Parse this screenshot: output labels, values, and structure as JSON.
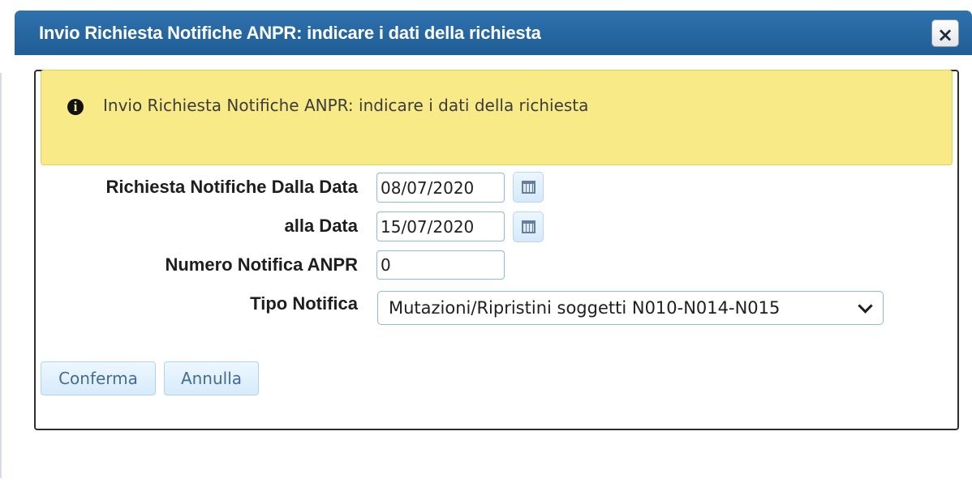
{
  "window": {
    "title": "Invio Richiesta Notifiche ANPR: indicare i dati della richiesta",
    "close_symbol": "×",
    "close_icon": "close-icon",
    "header_color": "#1f5d95"
  },
  "notice": {
    "icon": "info-icon",
    "icon_text": "i",
    "message": "Invio Richiesta Notifiche ANPR:  indicare i dati della richiesta",
    "background": "#f9ea88"
  },
  "form": {
    "from_date": {
      "label": "Richiesta Notifiche Dalla Data",
      "value": "08/07/2020",
      "icon": "calendar-icon"
    },
    "to_date": {
      "label": "alla Data",
      "value": "15/07/2020",
      "icon": "calendar-icon"
    },
    "notification_number": {
      "label": "Numero Notifica ANPR",
      "value": "0"
    },
    "notification_type": {
      "label": "Tipo Notifica",
      "selected": "Mutazioni/Ripristini soggetti N010-N014-N015",
      "icon": "chevron-down-icon"
    }
  },
  "actions": {
    "confirm_label": "Conferma",
    "cancel_label": "Annulla"
  },
  "colors": {
    "button_text": "#476b93",
    "button_border": "#b4d2ee",
    "input_border": "#8eb8dc"
  }
}
